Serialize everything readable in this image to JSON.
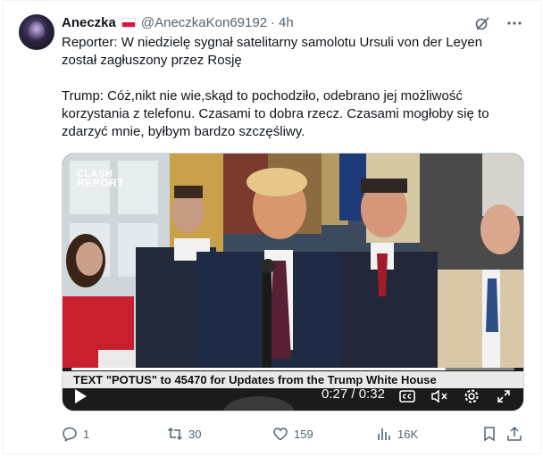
{
  "author": {
    "name": "Aneczka",
    "handle": "@AneczkaKon69192",
    "separator": "·",
    "time": "4h",
    "flag_colors": {
      "top": "#ffffff",
      "bottom": "#dc143c"
    }
  },
  "tweet": {
    "paragraph1": "Reporter: W niedzielę sygnał satelitarny samolotu Ursuli von der Leyen\nzostał zagłuszony przez Rosję",
    "paragraph2": "Trump: Cóż,nikt nie wie,skąd to pochodziło, odebrano jej możliwość\nkorzystania z telefonu. Czasami to dobra rzecz. Czasami mogłoby się to\nzdarzyć mnie, byłbym bardzo szczęśliwy."
  },
  "media": {
    "brand_line1": "CLASH",
    "brand_line2": "REPORT",
    "caption": "TEXT \"POTUS\" to 45470 for Updates from the Trump White House",
    "current_time": "0:27",
    "duration": "0:32",
    "time_separator": " / ",
    "progress": 0.844,
    "icons": [
      "play-icon",
      "captions-icon",
      "mute-icon",
      "settings-icon",
      "fullscreen-icon"
    ]
  },
  "actions": {
    "replies": "1",
    "reposts": "30",
    "likes": "159",
    "views": "16K"
  },
  "colors": {
    "text": "#0f1419",
    "secondary": "#536471",
    "border": "#eff3f4"
  }
}
